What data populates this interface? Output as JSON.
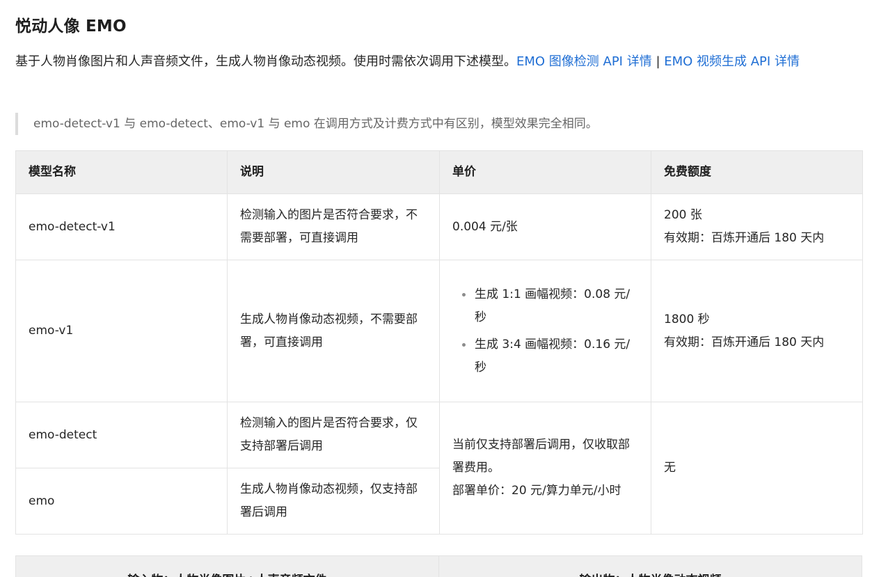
{
  "title": "悦动人像 EMO",
  "intro": {
    "text": "基于人物肖像图片和人声音频文件，生成人物肖像动态视频。使用时需依次调用下述模型。",
    "link1": "EMO 图像检测 API 详情",
    "separator": " | ",
    "link2": "EMO 视频生成 API 详情"
  },
  "note": "emo-detect-v1 与 emo-detect、emo-v1 与 emo 在调用方式及计费方式中有区别，模型效果完全相同。",
  "table": {
    "headers": [
      "模型名称",
      "说明",
      "单价",
      "免费额度"
    ],
    "rows": [
      {
        "name": "emo-detect-v1",
        "desc": "检测输入的图片是否符合要求，不需要部署，可直接调用",
        "price": "0.004 元/张",
        "quota_line1": "200 张",
        "quota_line2": "有效期：百炼开通后 180 天内"
      },
      {
        "name": "emo-v1",
        "desc": "生成人物肖像动态视频，不需要部署，可直接调用",
        "price_items": [
          "生成 1:1 画幅视频：0.08 元/秒",
          "生成 3:4 画幅视频：0.16 元/秒"
        ],
        "quota_line1": "1800 秒",
        "quota_line2": "有效期：百炼开通后 180 天内"
      },
      {
        "name": "emo-detect",
        "desc": "检测输入的图片是否符合要求，仅支持部署后调用"
      },
      {
        "name": "emo",
        "desc": "生成人物肖像动态视频，仅支持部署后调用"
      }
    ],
    "shared_price_line1": "当前仅支持部署后调用，仅收取部署费用。",
    "shared_price_line2": "部署单价：20 元/算力单元/小时",
    "shared_quota": "无"
  },
  "io_table": {
    "input_header": "输入物：人物肖像图片+人声音频文件",
    "output_header": "输出物：人物肖像动态视频"
  }
}
